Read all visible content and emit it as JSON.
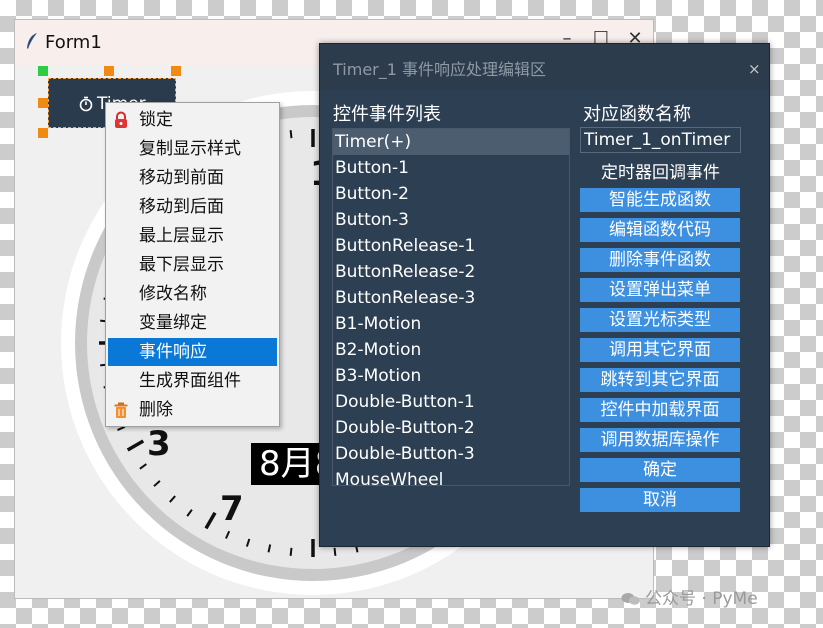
{
  "form": {
    "title": "Form1",
    "controls": {
      "minimize": "–",
      "maximize": "☐",
      "close": "✕"
    }
  },
  "clock": {
    "numerals": [
      "1",
      "3",
      "7"
    ],
    "date_text": "8月8"
  },
  "timer_widget": {
    "label": "Timer",
    "icon": "stopwatch-icon"
  },
  "context_menu": {
    "items": [
      {
        "label": "锁定",
        "icon": "lock-icon"
      },
      {
        "label": "复制显示样式"
      },
      {
        "label": "移动到前面"
      },
      {
        "label": "移动到后面"
      },
      {
        "label": "最上层显示"
      },
      {
        "label": "最下层显示"
      },
      {
        "label": "修改名称"
      },
      {
        "label": "变量绑定"
      },
      {
        "label": "事件响应",
        "selected": true
      },
      {
        "label": "生成界面组件"
      },
      {
        "label": "删除",
        "icon": "trash-icon"
      }
    ]
  },
  "dialog": {
    "title": "Timer_1 事件响应处理编辑区",
    "close": "×",
    "list_label": "控件事件列表",
    "func_label": "对应函数名称",
    "events": [
      "Timer(+)",
      "Button-1",
      "Button-2",
      "Button-3",
      "ButtonRelease-1",
      "ButtonRelease-2",
      "ButtonRelease-3",
      "B1-Motion",
      "B2-Motion",
      "B3-Motion",
      "Double-Button-1",
      "Double-Button-2",
      "Double-Button-3",
      "MouseWheel"
    ],
    "selected_event": "Timer(+)",
    "func_name": "Timer_1_onTimer",
    "func_desc": "定时器回调事件",
    "buttons": [
      "智能生成函数",
      "编辑函数代码",
      "删除事件函数",
      "设置弹出菜单",
      "设置光标类型",
      "调用其它界面",
      "跳转到其它界面",
      "控件中加载界面",
      "调用数据库操作",
      "确定",
      "取消"
    ]
  },
  "watermark": {
    "text": "公众号 · PyMe"
  },
  "colors": {
    "dialog_bg": "#2d3f52",
    "button_blue": "#3d8fe0",
    "menu_selected": "#0a78d7",
    "handle_orange": "#f08a12",
    "handle_green": "#2ecc40"
  }
}
